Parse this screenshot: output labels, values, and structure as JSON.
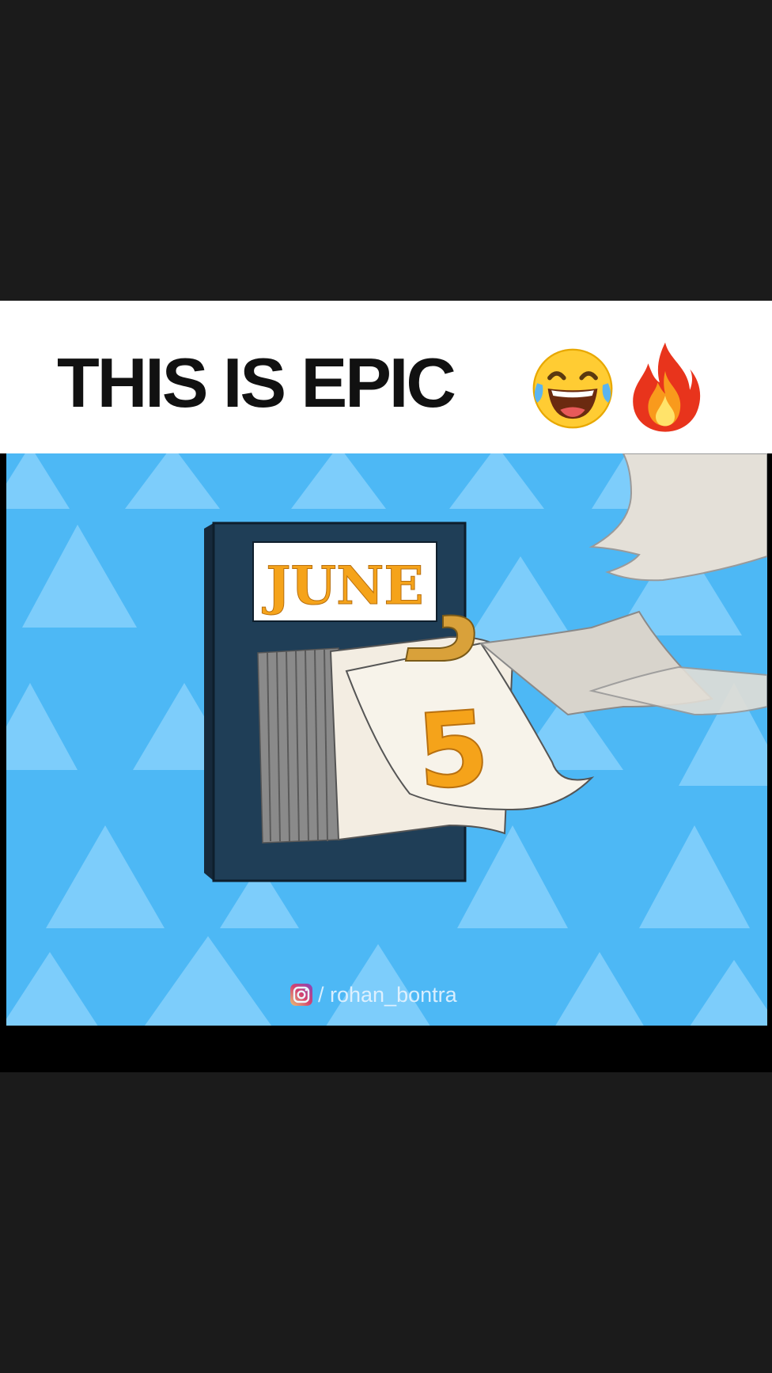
{
  "caption": {
    "text": "THIS IS EPIC",
    "emojis": [
      "laughing-tears-icon",
      "fire-icon"
    ]
  },
  "calendar": {
    "month": "JUNE",
    "day": "5"
  },
  "watermark": {
    "icon": "instagram-icon",
    "handle": "/ rohan_bontra"
  },
  "colors": {
    "background": "#1b1b1b",
    "caption_bar": "#ffffff",
    "scene_sky": "#4db8f5",
    "scene_triangles": "#7dcdfb",
    "calendar_body": "#1f3e57",
    "accent_orange": "#f5a31a"
  }
}
